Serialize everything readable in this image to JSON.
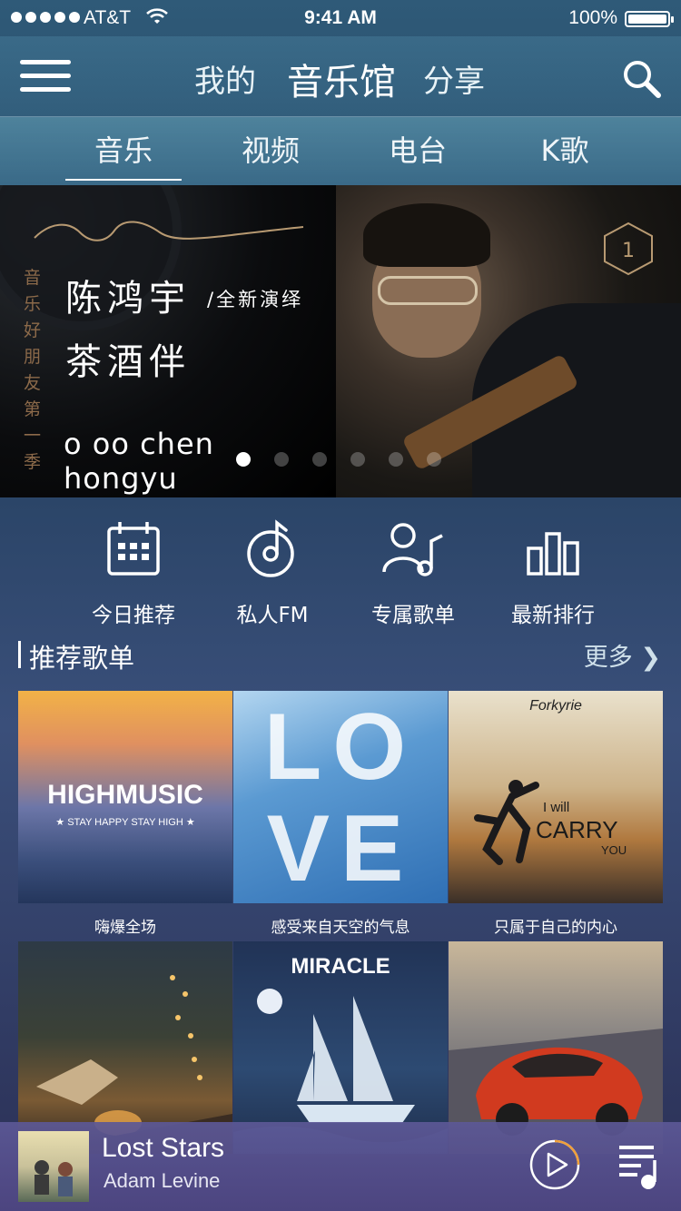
{
  "status_bar": {
    "carrier": "AT&T",
    "time": "9:41 AM",
    "battery": "100%"
  },
  "header": {
    "tabs": [
      {
        "label": "我的"
      },
      {
        "label": "音乐馆"
      },
      {
        "label": "分享"
      }
    ],
    "active_tab": "音乐馆"
  },
  "category_tabs": [
    {
      "label": "音乐"
    },
    {
      "label": "视频"
    },
    {
      "label": "电台"
    },
    {
      "label": "K歌"
    }
  ],
  "banner": {
    "side_text": "音乐好朋友第一季",
    "artist": "陈鸿宇",
    "tagline": "/全新演绎",
    "song": "茶酒伴",
    "english_name": "o oo chen hongyu",
    "badge": "1",
    "page_count": 6,
    "active_page": 1
  },
  "shortcuts": [
    {
      "label": "今日推荐",
      "icon": "calendar-icon"
    },
    {
      "label": "私人FM",
      "icon": "fm-disc-icon"
    },
    {
      "label": "专属歌单",
      "icon": "user-music-icon"
    },
    {
      "label": "最新排行",
      "icon": "chart-bars-icon"
    }
  ],
  "section": {
    "title": "推荐歌单",
    "more": "更多"
  },
  "playlists": [
    {
      "name": "嗨爆全场",
      "cover_title": "HIGHMUSIC",
      "cover_sub": "★ STAY HAPPY STAY HIGH ★"
    },
    {
      "name": "感受来自天空的气息",
      "cover_title": "LOVE"
    },
    {
      "name": "只属于自己的内心",
      "cover_title": "CARRY",
      "cover_pre": "I will",
      "cover_post": "YOU",
      "cover_brand": "Forkyrie"
    },
    {
      "name": ""
    },
    {
      "name": "",
      "cover_title": "MIRACLE"
    },
    {
      "name": ""
    }
  ],
  "player": {
    "song": "Lost Stars",
    "artist": "Adam Levine"
  },
  "colors": {
    "player_bg": "#5c5896",
    "accent_white": "#ffffff"
  }
}
